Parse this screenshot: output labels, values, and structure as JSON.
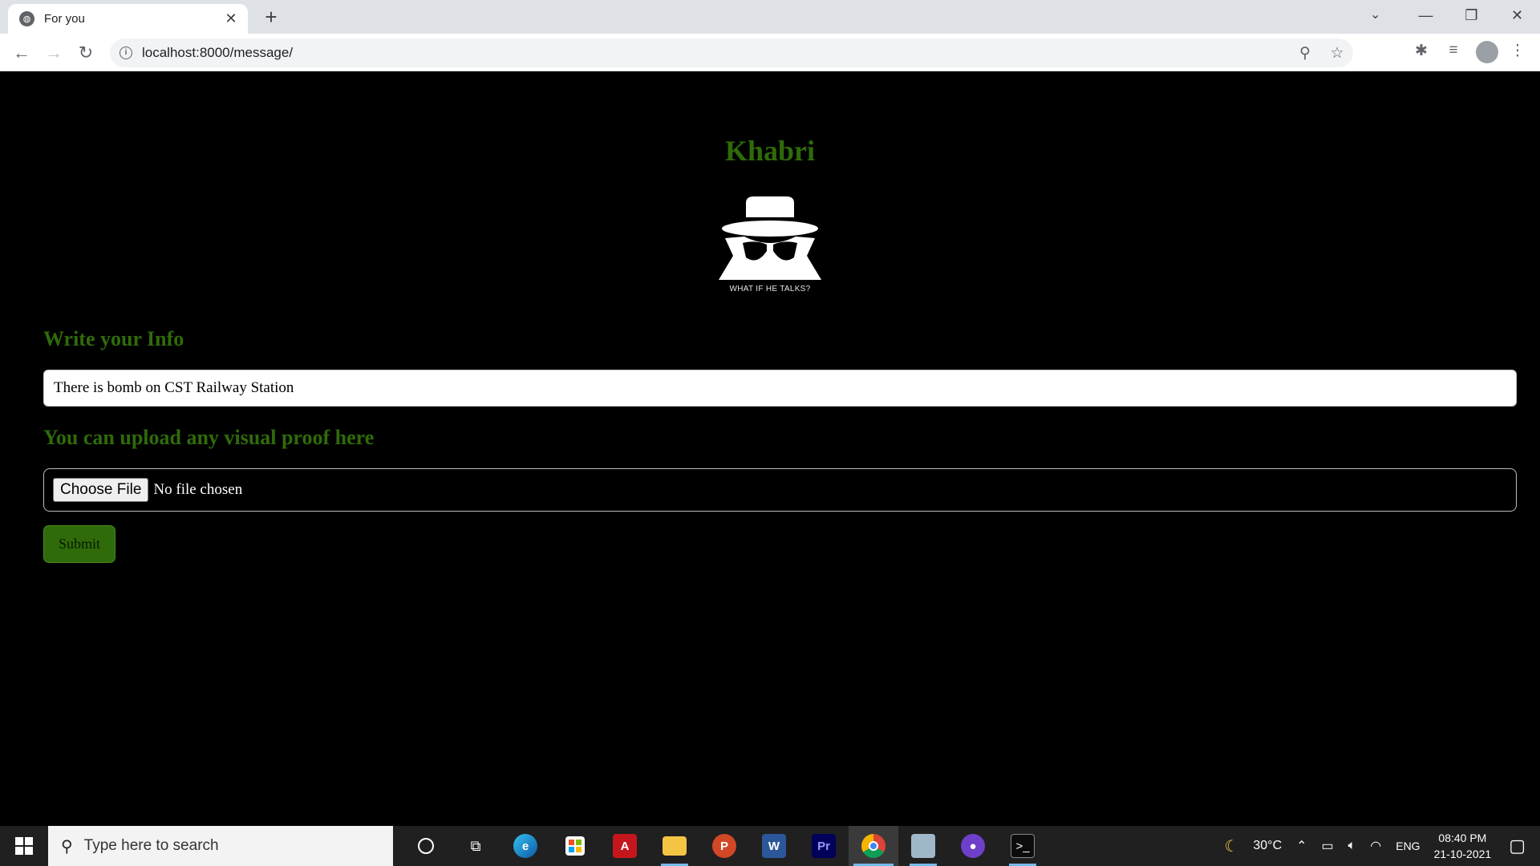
{
  "browser": {
    "tab_title": "For you",
    "url": "localhost:8000/message/",
    "tab_close": "✕",
    "new_tab": "+",
    "icons": [
      "globe-icon",
      "close-icon",
      "plus-icon",
      "back-icon",
      "forward-icon",
      "reload-icon",
      "info-icon",
      "zoom-icon",
      "star-icon",
      "extensions-icon",
      "media-icon",
      "profile-icon",
      "menu-icon"
    ]
  },
  "page": {
    "site_title": "Khabri",
    "logo_caption": "WHAT IF HE TALKS?",
    "info_heading": "Write your Info",
    "info_value": "There is bomb on CST Railway Station",
    "upload_heading": "You can upload any visual proof here",
    "choose_file_label": "Choose File",
    "no_file_text": "No file chosen",
    "submit_label": "Submit",
    "accent_color": "#2f6b0a"
  },
  "taskbar": {
    "search_placeholder": "Type here to search",
    "weather": "30°C",
    "language": "ENG",
    "time": "08:40 PM",
    "date": "21-10-2021",
    "apps": [
      "cortana",
      "task-view",
      "edge",
      "store",
      "acrobat",
      "file-explorer",
      "powerpoint",
      "word",
      "premiere",
      "chrome",
      "photos",
      "github-desktop",
      "terminal"
    ]
  }
}
